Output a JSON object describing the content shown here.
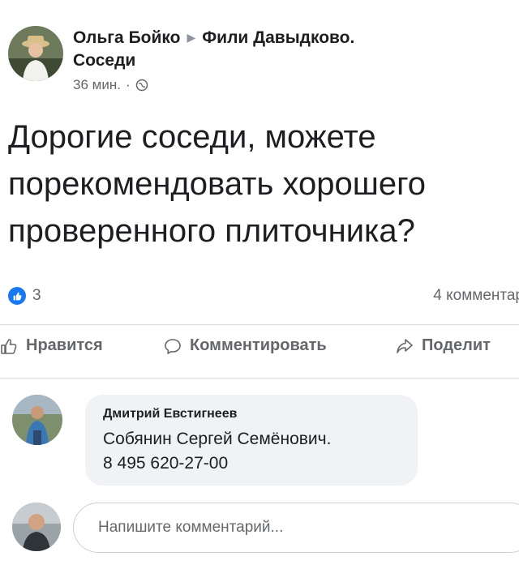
{
  "post": {
    "author": "Ольга Бойко",
    "group_line1": "Фили Давыдково.",
    "group_line2": "Соседи",
    "time": "36 мин.",
    "text": "Дорогие соседи, можете порекомендовать хорошего проверенного плиточника?"
  },
  "reactions": {
    "likes": "3",
    "comments": "4 комментар"
  },
  "actions": {
    "like": "Нравится",
    "comment": "Комментировать",
    "share": "Поделит"
  },
  "comment": {
    "author": "Дмитрий Евстигнеев",
    "text": "Собянин Сергей Семёнович.\n8 495 620-27-00"
  },
  "composer": {
    "placeholder": "Напишите комментарий..."
  },
  "icons": {
    "like": "thumbs-up-icon",
    "comment": "speech-bubble-icon",
    "share": "share-arrow-icon",
    "privacy": "globe-icon"
  },
  "colors": {
    "accent": "#1877f2",
    "muted": "#65676b",
    "bubble": "#f0f2f5"
  }
}
